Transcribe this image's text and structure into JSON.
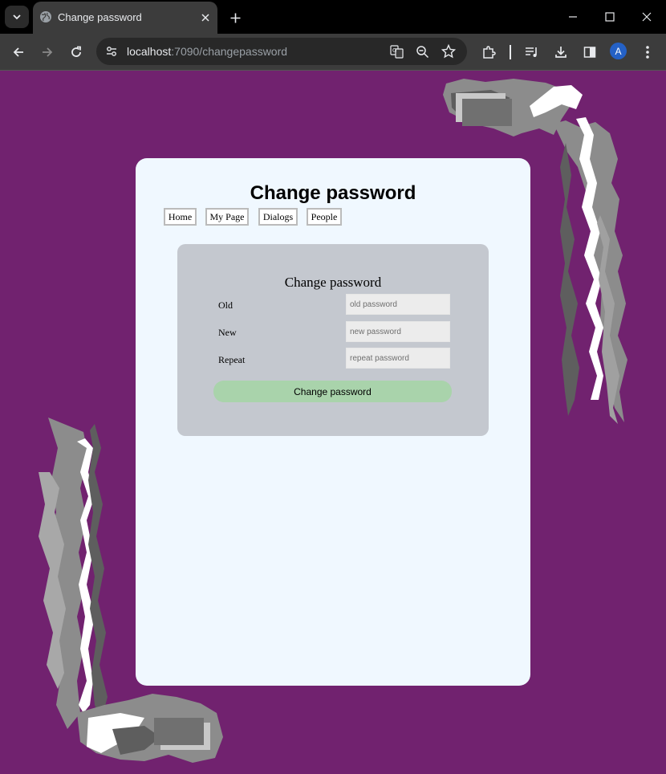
{
  "browser": {
    "tab_title": "Change password",
    "url_host": "localhost",
    "url_path": ":7090/changepassword",
    "profile_initial": "A"
  },
  "page": {
    "title": "Change password",
    "nav": [
      {
        "label": "Home"
      },
      {
        "label": "My Page"
      },
      {
        "label": "Dialogs"
      },
      {
        "label": "People"
      }
    ],
    "form": {
      "title": "Change password",
      "old_label": "Old",
      "old_placeholder": "old password",
      "new_label": "New",
      "new_placeholder": "new password",
      "repeat_label": "Repeat",
      "repeat_placeholder": "repeat password",
      "submit_label": "Change password"
    }
  },
  "colors": {
    "page_background": "#71226f",
    "card_background": "#f0f8ff",
    "form_background": "#c4c8cf",
    "submit_background": "#a9d3ab"
  }
}
